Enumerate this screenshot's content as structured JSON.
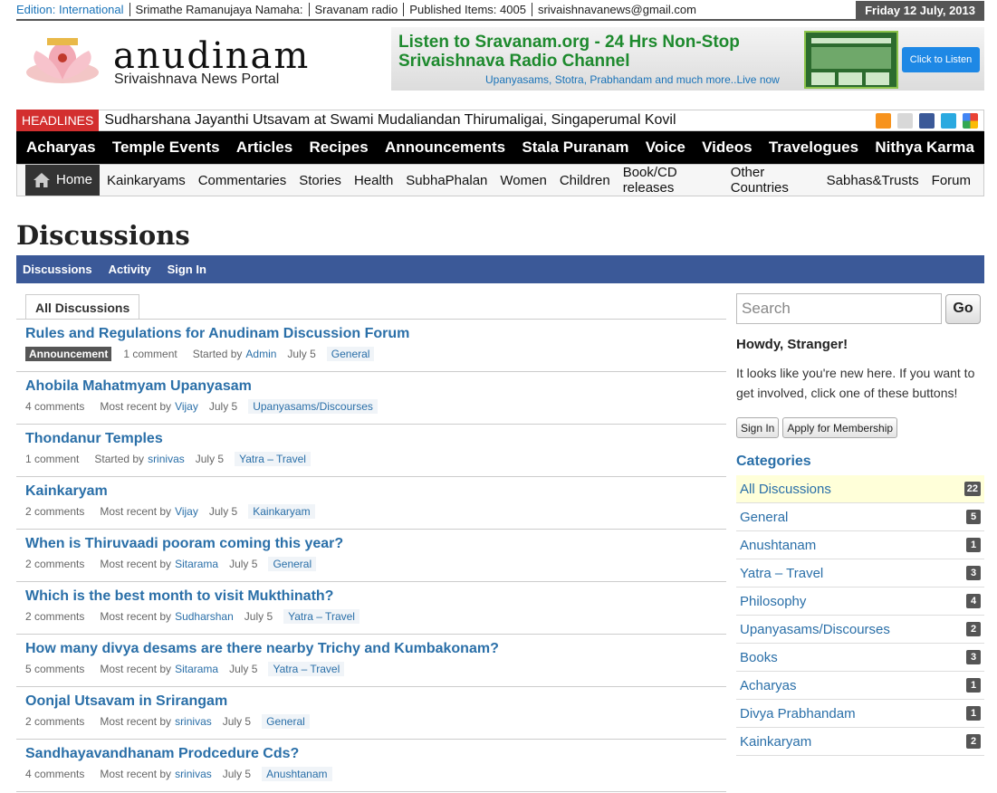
{
  "topbar": {
    "edition": "Edition: International",
    "greeting": "Srimathe Ramanujaya Namaha:",
    "radio": "Sravanam radio",
    "published": "Published Items: 4005",
    "email": "srivaishnavanews@gmail.com",
    "date": "Friday 12 July, 2013"
  },
  "logo": {
    "name": "anudinam",
    "tagline": "Srivaishnava News Portal"
  },
  "banner": {
    "title_line1": "Listen to Sravanam.org - 24 Hrs Non-Stop",
    "title_line2": "Srivaishnava Radio Channel",
    "subtitle": "Upanyasams, Stotra, Prabhandam and much more..Live now",
    "button": "Click to Listen"
  },
  "headlines": {
    "label": "HEADLINES",
    "text": "Sudharshana Jayanthi Utsavam at Swami Mudaliandan Thirumaligai, Singaperumal Kovil"
  },
  "social_icons": [
    "rss-icon",
    "mail-icon",
    "facebook-icon",
    "twitter-icon",
    "google-icon"
  ],
  "main_nav": [
    "Acharyas",
    "Temple Events",
    "Articles",
    "Recipes",
    "Announcements",
    "Stala Puranam",
    "Voice",
    "Videos",
    "Travelogues",
    "Nithya Karma"
  ],
  "sub_nav": {
    "home": "Home",
    "items": [
      "Kainkaryams",
      "Commentaries",
      "Stories",
      "Health",
      "SubhaPhalan",
      "Women",
      "Children",
      "Book/CD releases",
      "Other Countries",
      "Sabhas&Trusts",
      "Forum"
    ]
  },
  "page": {
    "title": "Discussions",
    "menu": [
      "Discussions",
      "Activity",
      "Sign In"
    ],
    "tab": "All Discussions"
  },
  "discussions": [
    {
      "title": "Rules and Regulations for Anudinam Discussion Forum",
      "badge": "Announcement",
      "count": "1 comment",
      "by_label": "Started by",
      "user": "Admin",
      "date": "July 5",
      "category": "General"
    },
    {
      "title": "Ahobila Mahatmyam Upanyasam",
      "badge": "",
      "count": "4 comments",
      "by_label": "Most recent by",
      "user": "Vijay",
      "date": "July 5",
      "category": "Upanyasams/Discourses"
    },
    {
      "title": "Thondanur Temples",
      "badge": "",
      "count": "1 comment",
      "by_label": "Started by",
      "user": "srinivas",
      "date": "July 5",
      "category": "Yatra – Travel"
    },
    {
      "title": "Kainkaryam",
      "badge": "",
      "count": "2 comments",
      "by_label": "Most recent by",
      "user": "Vijay",
      "date": "July 5",
      "category": "Kainkaryam"
    },
    {
      "title": "When is Thiruvaadi pooram coming this year?",
      "badge": "",
      "count": "2 comments",
      "by_label": "Most recent by",
      "user": "Sitarama",
      "date": "July 5",
      "category": "General"
    },
    {
      "title": "Which is the best month to visit Mukthinath?",
      "badge": "",
      "count": "2 comments",
      "by_label": "Most recent by",
      "user": "Sudharshan",
      "date": "July 5",
      "category": "Yatra – Travel"
    },
    {
      "title": "How many divya desams are there nearby Trichy and Kumbakonam?",
      "badge": "",
      "count": "5 comments",
      "by_label": "Most recent by",
      "user": "Sitarama",
      "date": "July 5",
      "category": "Yatra – Travel"
    },
    {
      "title": "Oonjal Utsavam in Srirangam",
      "badge": "",
      "count": "2 comments",
      "by_label": "Most recent by",
      "user": "srinivas",
      "date": "July 5",
      "category": "General"
    },
    {
      "title": "Sandhayavandhanam Prodcedure Cds?",
      "badge": "",
      "count": "4 comments",
      "by_label": "Most recent by",
      "user": "srinivas",
      "date": "July 5",
      "category": "Anushtanam"
    }
  ],
  "sidebar": {
    "search_placeholder": "Search",
    "go": "Go",
    "howdy": "Howdy, Stranger!",
    "welcome": "It looks like you're new here. If you want to get involved, click one of these buttons!",
    "sign_in": "Sign In",
    "apply": "Apply for Membership",
    "categories_heading": "Categories",
    "categories": [
      {
        "name": "All Discussions",
        "count": "22"
      },
      {
        "name": "General",
        "count": "5"
      },
      {
        "name": "Anushtanam",
        "count": "1"
      },
      {
        "name": "Yatra – Travel",
        "count": "3"
      },
      {
        "name": "Philosophy",
        "count": "4"
      },
      {
        "name": "Upanyasams/Discourses",
        "count": "2"
      },
      {
        "name": "Books",
        "count": "3"
      },
      {
        "name": "Acharyas",
        "count": "1"
      },
      {
        "name": "Divya Prabhandam",
        "count": "1"
      },
      {
        "name": "Kainkaryam",
        "count": "2"
      }
    ]
  },
  "colors": {
    "accent": "#3b5998",
    "link": "#2a6fa8",
    "headline_red": "#d32f2f",
    "banner_green": "#1e8a2e"
  }
}
